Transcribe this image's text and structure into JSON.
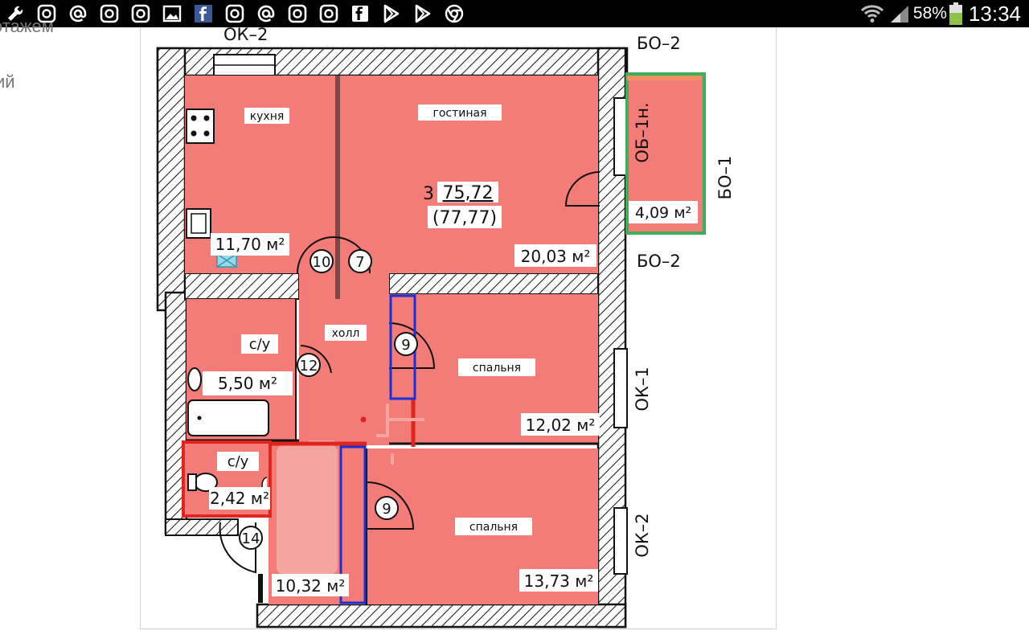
{
  "status_bar": {
    "battery_percent": "58%",
    "time": "13:34",
    "icons": [
      "wrench-icon",
      "instagram-icon",
      "at-sign-icon",
      "instagram-icon",
      "instagram-icon",
      "image-icon",
      "facebook-icon",
      "instagram-icon",
      "at-sign-icon",
      "instagram-icon",
      "instagram-icon",
      "fb-messenger-icon",
      "play-store-icon",
      "play-store-icon",
      "chrome-icon"
    ],
    "colors": {
      "background": "#000000",
      "battery_fill": "#8bc34a"
    }
  },
  "background_page": {
    "line1": "этажем",
    "line2": "ий"
  },
  "floor_plan": {
    "colors": {
      "room_fill": "#f47c78",
      "wall_hatch": "#222222",
      "highlight_red": "#e0241e",
      "highlight_blue": "#1a2fd6",
      "balcony_frame": "#3fae5a"
    },
    "window_labels": {
      "top": "ОК–2",
      "top_right": "БО–2",
      "right_balcony": "БО–1",
      "below_balcony": "БО–2",
      "balcony_door": "ОБ–1н.",
      "bedroom1_window": "ОК–1",
      "bedroom2_window": "ОК–2"
    },
    "rooms": {
      "kitchen": {
        "name": "кухня",
        "area": "11,70 м²"
      },
      "living": {
        "name": "гостиная",
        "area": "20,03 м²"
      },
      "balcony": {
        "area": "4,09 м²"
      },
      "apartment": {
        "rooms": "3",
        "area": "75,72",
        "total": "(77,77)"
      },
      "bathroom": {
        "name": "с/у",
        "area": "5,50 м²"
      },
      "hall": {
        "name": "холл",
        "area": "10,32 м²"
      },
      "bedroom1": {
        "name": "спальня",
        "area": "12,02 м²"
      },
      "toilet": {
        "name": "с/у",
        "area": "2,42 м²"
      },
      "bedroom2": {
        "name": "спальня",
        "area": "13,73 м²"
      }
    },
    "door_markers": {
      "kitchen_door": "10",
      "living_door": "7",
      "bathroom_door": "12",
      "bedroom1_door": "9",
      "bedroom2_door": "9",
      "entrance_door": "14"
    }
  }
}
